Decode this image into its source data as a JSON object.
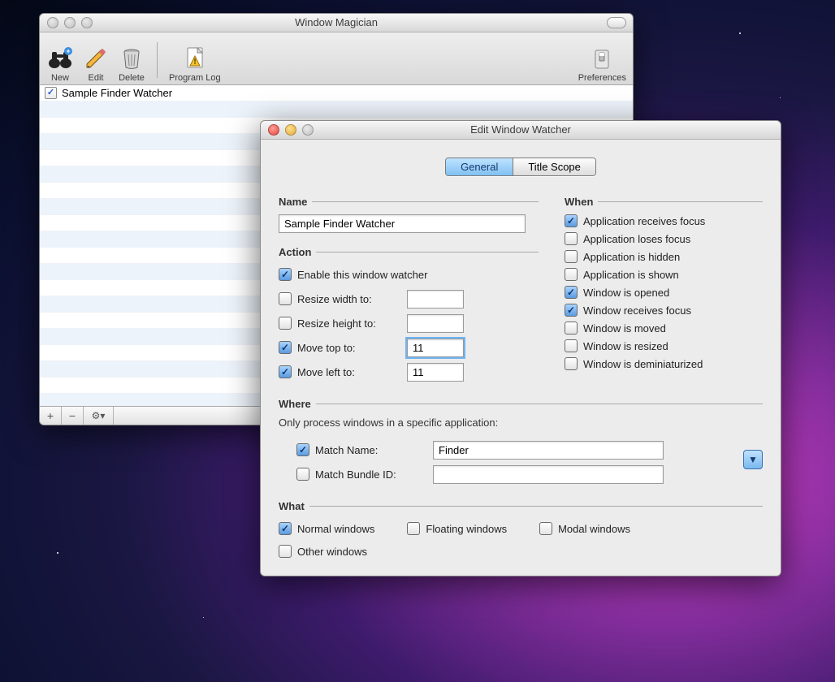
{
  "desktop": {
    "tiny_stars": true
  },
  "main_window": {
    "title": "Window Magician",
    "toolbar": {
      "new": "New",
      "edit": "Edit",
      "delete": "Delete",
      "program_log": "Program Log",
      "preferences": "Preferences"
    },
    "list": {
      "items": [
        {
          "checked": true,
          "text": "Sample Finder Watcher"
        }
      ],
      "blank_rows": 20
    },
    "footer": {
      "add": "+",
      "remove": "−",
      "gear": "✻▾"
    }
  },
  "edit_window": {
    "title": "Edit Window Watcher",
    "tabs": {
      "general": "General",
      "title_scope": "Title Scope"
    },
    "sections": {
      "name": "Name",
      "action": "Action",
      "when": "When",
      "where": "Where",
      "what": "What"
    },
    "name_value": "Sample Finder Watcher",
    "action": {
      "enable": {
        "label": "Enable this window watcher",
        "checked": true
      },
      "resize_width": {
        "label": "Resize width to:",
        "checked": false,
        "value": ""
      },
      "resize_height": {
        "label": "Resize height to:",
        "checked": false,
        "value": ""
      },
      "move_top": {
        "label": "Move top to:",
        "checked": true,
        "value": "11"
      },
      "move_left": {
        "label": "Move left to:",
        "checked": true,
        "value": "11"
      }
    },
    "when": [
      {
        "label": "Application receives focus",
        "checked": true
      },
      {
        "label": "Application loses focus",
        "checked": false
      },
      {
        "label": "Application is hidden",
        "checked": false
      },
      {
        "label": "Application is shown",
        "checked": false
      },
      {
        "label": "Window is opened",
        "checked": true
      },
      {
        "label": "Window receives focus",
        "checked": true
      },
      {
        "label": "Window is moved",
        "checked": false
      },
      {
        "label": "Window is resized",
        "checked": false
      },
      {
        "label": "Window is deminiaturized",
        "checked": false
      }
    ],
    "where": {
      "hint": "Only process windows in a specific application:",
      "match_name": {
        "label": "Match Name:",
        "checked": true,
        "value": "Finder"
      },
      "match_bundle": {
        "label": "Match Bundle ID:",
        "checked": false,
        "value": ""
      }
    },
    "what": {
      "normal": {
        "label": "Normal windows",
        "checked": true
      },
      "floating": {
        "label": "Floating windows",
        "checked": false
      },
      "modal": {
        "label": "Modal windows",
        "checked": false
      },
      "other": {
        "label": "Other windows",
        "checked": false
      }
    }
  }
}
